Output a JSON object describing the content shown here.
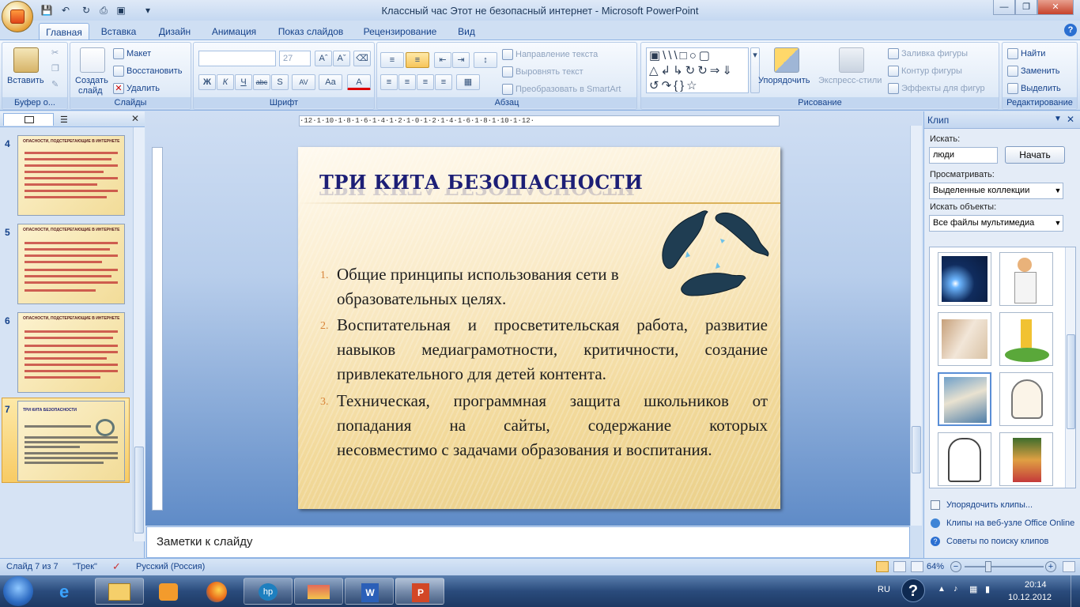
{
  "app": {
    "window_title": "Классный час Этот не безопасный интернет - Microsoft PowerPoint"
  },
  "ribbon_tabs": [
    "Главная",
    "Вставка",
    "Дизайн",
    "Анимация",
    "Показ слайдов",
    "Рецензирование",
    "Вид"
  ],
  "active_tab": "Главная",
  "ribbon": {
    "clipboard": {
      "label": "Буфер о...",
      "paste": "Вставить"
    },
    "slides": {
      "label": "Слайды",
      "create": "Создать",
      "create2": "слайд",
      "layout": "Макет",
      "reset": "Восстановить",
      "delete": "Удалить"
    },
    "font": {
      "label": "Шрифт",
      "size": "27"
    },
    "paragraph": {
      "label": "Абзац",
      "text_direction": "Направление текста",
      "align_text": "Выровнять текст",
      "smartart": "Преобразовать в SmartArt"
    },
    "drawing": {
      "label": "Рисование",
      "arrange": "Упорядочить",
      "quick_styles": "Экспресс-стили",
      "shape_fill": "Заливка фигуры",
      "shape_outline": "Контур фигуры",
      "shape_effects": "Эффекты для фигур"
    },
    "editing": {
      "label": "Редактирование",
      "find": "Найти",
      "replace": "Заменить",
      "select": "Выделить"
    }
  },
  "rulers": {
    "horizontal": "·12·1·10·1·8·1·6·1·4·1·2·1·0·1·2·1·4·1·6·1·8·1·10·1·12·"
  },
  "slide_thumbs": [
    {
      "num": "4",
      "title": "ОПАСНОСТИ, ПОДСТЕРЕГАЮЩИЕ В ИНТЕРНЕТЕ"
    },
    {
      "num": "5",
      "title": "ОПАСНОСТИ, ПОДСТЕРЕГАЮЩИЕ В ИНТЕРНЕТЕ"
    },
    {
      "num": "6",
      "title": "ОПАСНОСТИ, ПОДСТЕРЕГАЮЩИЕ В ИНТЕРНЕТЕ"
    },
    {
      "num": "7",
      "title": "ТРИ КИТА БЕЗОПАСНОСТИ"
    }
  ],
  "slide": {
    "title": "ТРИ КИТА БЕЗОПАСНОСТИ",
    "items": [
      {
        "n": "1.",
        "lines": [
          "Общие принципы использования сети в",
          "образовательных целях."
        ]
      },
      {
        "n": "2.",
        "lines": [
          "Воспитательная и просветительская работа, развитие",
          "навыков медиаграмотности, критичности, создание",
          "привлекательного для детей контента."
        ]
      },
      {
        "n": "3.",
        "lines": [
          "Техническая, программная защита школьников от",
          "попадания на сайты, содержание которых",
          "несовместимо с задачами образования и воспитания."
        ]
      }
    ]
  },
  "notes_placeholder": "Заметки к слайду",
  "clip_panel": {
    "title": "Клип",
    "search_label": "Искать:",
    "search_value": "люди",
    "search_button": "Начать",
    "browse_label": "Просматривать:",
    "browse_value": "Выделенные коллекции",
    "objects_label": "Искать объекты:",
    "objects_value": "Все файлы мультимедиа",
    "links": [
      "Упорядочить клипы...",
      "Клипы на веб-узле Office Online",
      "Советы по поиску клипов"
    ]
  },
  "status": {
    "slide": "Слайд 7 из 7",
    "theme": "\"Трек\"",
    "language": "Русский (Россия)",
    "zoom": "64%"
  },
  "taskbar": {
    "lang": "RU",
    "time": "20:14",
    "date": "10.12.2012"
  }
}
